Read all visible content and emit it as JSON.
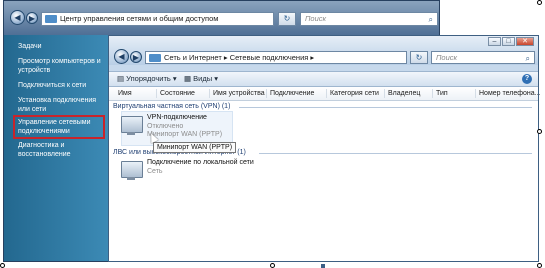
{
  "back_window": {
    "address": "Центр управления сетями и общим доступом",
    "search_placeholder": "Поиск",
    "sidebar": [
      {
        "label": "Задачи"
      },
      {
        "label": "Просмотр компьютеров и устройств"
      },
      {
        "label": "Подключиться к сети"
      },
      {
        "label": "Установка подключения или сети"
      },
      {
        "label": "Управление сетевыми подключениями"
      },
      {
        "label": "Диагностика и восстановление"
      }
    ]
  },
  "front_window": {
    "breadcrumb": [
      "Сеть и Интернет",
      "Сетевые подключения"
    ],
    "search_placeholder": "Поиск",
    "toolbar": {
      "organize": "Упорядочить",
      "views": "Виды"
    },
    "columns": [
      "Имя",
      "Состояние",
      "Имя устройства",
      "Подключение",
      "Категория сети",
      "Владелец",
      "Тип",
      "Номер телефона..."
    ],
    "groups": [
      {
        "title": "Виртуальная частная сеть (VPN) (1)",
        "items": [
          {
            "name": "VPN-подключение",
            "status": "Отключено",
            "device": "Минипорт WAN (PPTP)"
          }
        ]
      },
      {
        "title": "ЛВС или высокоскоростной Интернет (1)",
        "items": [
          {
            "name": "Подключение по локальной сети",
            "status": "Сеть"
          }
        ]
      }
    ],
    "tooltip": "Минипорт WAN (PPTP)"
  },
  "colors": {
    "highlight_border": "#c8242b",
    "sidebar_bg": "#2b7aa8",
    "group_text": "#1f3f72"
  },
  "icons": [
    "back-icon",
    "forward-icon",
    "folder-icon",
    "refresh-icon",
    "search-icon",
    "network-connection-icon",
    "help-icon",
    "organize-icon",
    "views-icon"
  ]
}
